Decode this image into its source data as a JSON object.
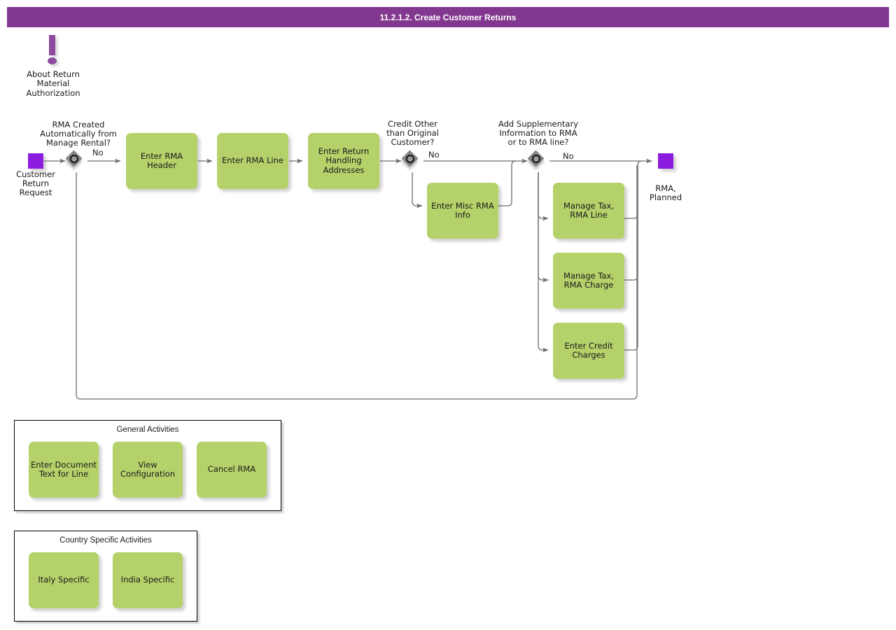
{
  "header": {
    "title": "11.2.1.2. Create Customer Returns",
    "bg_color": "#83388f",
    "text_color": "#ffffff"
  },
  "palette": {
    "task_green": "#b5d16a",
    "event_purple": "#8b1ce0",
    "annotation_purple": "#8e4a9e",
    "gateway_gray": "#848484",
    "connector_gray": "#6e6e6e"
  },
  "annotation": {
    "icon": "exclamation-mark-icon",
    "text": "About Return\nMaterial\nAuthorization"
  },
  "events": {
    "start": {
      "name": "customer-return-request",
      "label": "Customer\nReturn\nRequest"
    },
    "end": {
      "name": "rma-planned",
      "label": "RMA,\nPlanned"
    }
  },
  "gateways": [
    {
      "id": "gw-rma-created",
      "question": "RMA Created\nAutomatically from\nManage Rental?",
      "flow_label": "No"
    },
    {
      "id": "gw-credit-other",
      "question": "Credit Other\nthan Original\nCustomer?",
      "flow_label": "No"
    },
    {
      "id": "gw-add-supplementary",
      "question": "Add Supplementary\nInformation to RMA\nor to RMA line?",
      "flow_label": "No"
    }
  ],
  "tasks": {
    "enter_rma_header": "Enter RMA\nHeader",
    "enter_rma_line": "Enter RMA Line",
    "enter_return_handling_addresses": "Enter Return\nHandling\nAddresses",
    "enter_misc_rma_info": "Enter Misc RMA\nInfo",
    "manage_tax_rma_line": "Manage Tax,\nRMA Line",
    "manage_tax_rma_charge": "Manage Tax,\nRMA Charge",
    "enter_credit_charges": "Enter Credit\nCharges"
  },
  "groups": [
    {
      "id": "general-activities",
      "title": "General Activities",
      "items": [
        "Enter Document\nText for Line",
        "View\nConfiguration",
        "Cancel RMA"
      ]
    },
    {
      "id": "country-specific-activities",
      "title": "Country Specific Activities",
      "items": [
        "Italy Specific",
        "India Specific"
      ]
    }
  ]
}
